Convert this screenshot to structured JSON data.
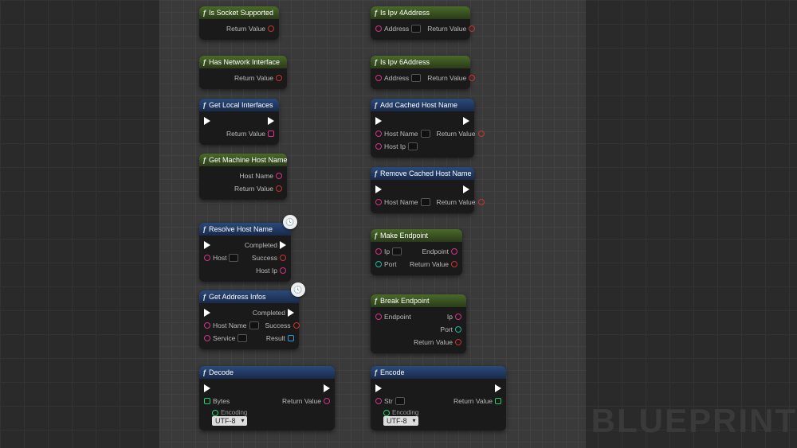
{
  "watermark": "BLUEPRINT",
  "dropdown_default": "UTF-8",
  "labels": {
    "return_value": "Return Value",
    "address": "Address",
    "host_name": "Host Name",
    "host_ip": "Host Ip",
    "host": "Host",
    "completed": "Completed",
    "success": "Success",
    "result": "Result",
    "service": "Service",
    "ip": "Ip",
    "port": "Port",
    "endpoint": "Endpoint",
    "bytes": "Bytes",
    "str": "Str",
    "encoding": "Encoding"
  },
  "nodes": {
    "is_socket_supported": "Is Socket Supported",
    "is_ipv4": "Is Ipv 4Address",
    "has_network_interface": "Has Network Interface",
    "is_ipv6": "Is Ipv 6Address",
    "get_local_interfaces": "Get Local Interfaces",
    "add_cached_host": "Add Cached Host Name",
    "get_machine_host": "Get Machine Host Name",
    "remove_cached_host": "Remove Cached Host Name",
    "resolve_host_name": "Resolve Host Name",
    "make_endpoint": "Make Endpoint",
    "get_address_infos": "Get Address Infos",
    "break_endpoint": "Break Endpoint",
    "decode": "Decode",
    "encode": "Encode"
  }
}
